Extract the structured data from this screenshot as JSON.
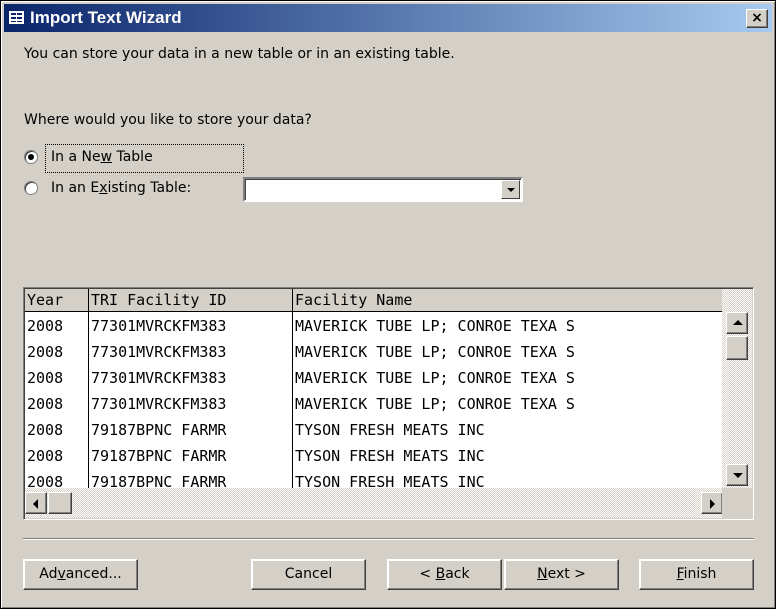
{
  "window": {
    "title": "Import Text Wizard",
    "close_label": "×"
  },
  "intro": "You can store your data in a new table or in an existing table.",
  "question": "Where would you like to store your data?",
  "options": {
    "new_table": {
      "before": "In a Ne",
      "accel": "w",
      "after": " Table",
      "checked": true
    },
    "existing_table": {
      "before": "In an E",
      "accel": "x",
      "after": "isting Table:",
      "checked": false
    }
  },
  "existing_table_combo": {
    "value": ""
  },
  "preview": {
    "columns": [
      "Year",
      "TRI Facility ID",
      "Facility Name"
    ],
    "rows": [
      [
        "2008",
        "77301MVRCKFM383",
        "MAVERICK TUBE LP; CONROE TEXA S"
      ],
      [
        "2008",
        "77301MVRCKFM383",
        "MAVERICK TUBE LP; CONROE TEXA S"
      ],
      [
        "2008",
        "77301MVRCKFM383",
        "MAVERICK TUBE LP; CONROE TEXA S"
      ],
      [
        "2008",
        "77301MVRCKFM383",
        "MAVERICK TUBE LP; CONROE TEXA S"
      ],
      [
        "2008",
        "79187BPNC FARMR",
        "TYSON FRESH MEATS INC"
      ],
      [
        "2008",
        "79187BPNC FARMR",
        "TYSON FRESH MEATS INC"
      ],
      [
        "2008",
        "79187BPNC FARMR",
        "TYSON FRESH MEATS INC"
      ]
    ]
  },
  "buttons": {
    "advanced": {
      "before": "Ad",
      "accel": "v",
      "after": "anced..."
    },
    "cancel": {
      "label": "Cancel"
    },
    "back": {
      "before": "< ",
      "accel": "B",
      "after": "ack"
    },
    "next": {
      "before": "",
      "accel": "N",
      "after": "ext >"
    },
    "finish": {
      "before": "",
      "accel": "F",
      "after": "inish"
    }
  },
  "icons": [
    "wizard-window-icon",
    "close-icon",
    "combo-dropdown-icon",
    "scroll-up-icon",
    "scroll-down-icon",
    "scroll-left-icon",
    "scroll-right-icon"
  ]
}
